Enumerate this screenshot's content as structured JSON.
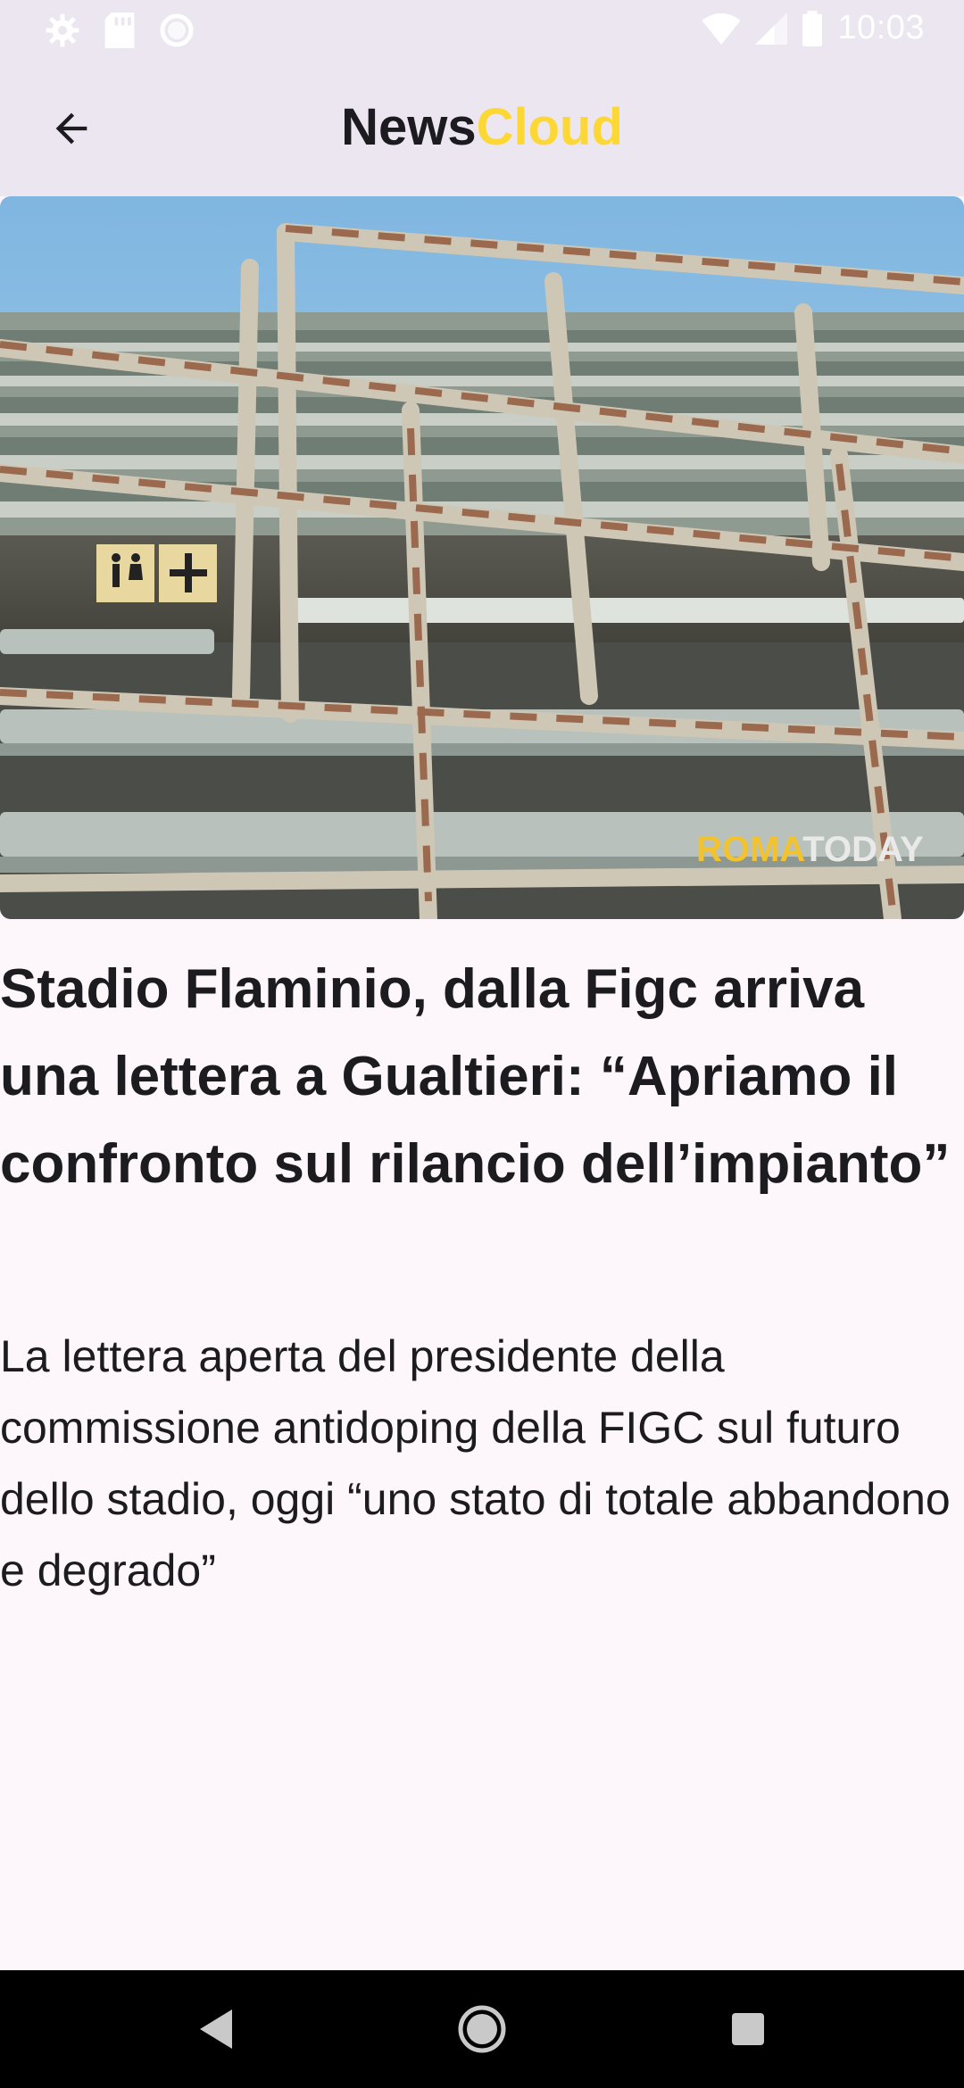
{
  "status_bar": {
    "time": "10:03",
    "icons": [
      "gear-icon",
      "sd-card-icon",
      "circle-icon",
      "wifi-icon",
      "signal-icon",
      "battery-icon"
    ]
  },
  "app_bar": {
    "title_part1": "News",
    "title_part2": "Cloud",
    "title_part1_color": "#1c1b1f",
    "title_part2_color": "#fdd835",
    "back_icon": "arrow-left-icon"
  },
  "article": {
    "image_watermark_part1": "ROMA",
    "image_watermark_part2": "TODAY",
    "headline": "Stadio Flaminio, dalla Figc arriva una lettera a Gualtieri: “Apriamo il confronto sul rilancio dell’impianto”",
    "summary": "La lettera aperta del presidente della commissione antidoping della FIGC sul futuro dello stadio, oggi “uno stato di totale abbandono e degrado”"
  },
  "nav_bar": {
    "icons": [
      "back-triangle-icon",
      "home-circle-icon",
      "recents-square-icon"
    ]
  }
}
